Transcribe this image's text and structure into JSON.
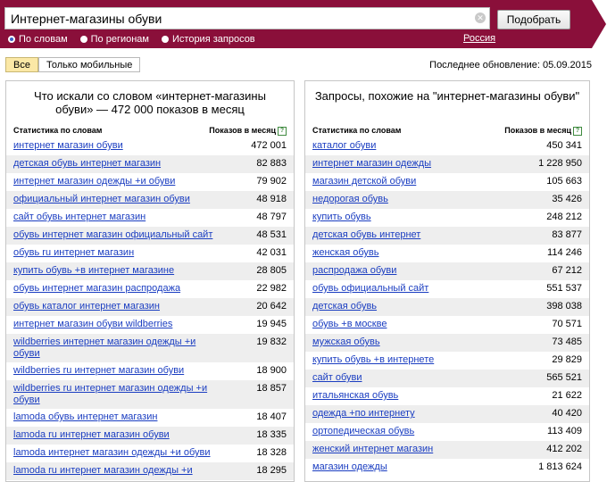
{
  "search": {
    "query": "Интернет-магазины обуви",
    "clear_symbol": "⊗",
    "button": "Подобрать",
    "modes": [
      "По словам",
      "По регионам",
      "История запросов"
    ],
    "region": "Россия"
  },
  "filters": {
    "all": "Все",
    "mobile": "Только мобильные"
  },
  "last_update": "Последнее обновление: 05.09.2015",
  "left_panel": {
    "title": "Что искали со словом «интернет-магазины обуви» — 472 000 показов в месяц",
    "col_phrase": "Статистика по словам",
    "col_count": "Показов в месяц",
    "help": "?",
    "rows": [
      {
        "phrase": "интернет магазин обуви",
        "count": "472 001"
      },
      {
        "phrase": "детская обувь интернет магазин",
        "count": "82 883"
      },
      {
        "phrase": "интернет магазин одежды +и обуви",
        "count": "79 902"
      },
      {
        "phrase": "официальный интернет магазин обуви",
        "count": "48 918"
      },
      {
        "phrase": "сайт обувь интернет магазин",
        "count": "48 797"
      },
      {
        "phrase": "обувь интернет магазин официальный сайт",
        "count": "48 531"
      },
      {
        "phrase": "обувь ru интернет магазин",
        "count": "42 031"
      },
      {
        "phrase": "купить обувь +в интернет магазине",
        "count": "28 805"
      },
      {
        "phrase": "обувь интернет магазин распродажа",
        "count": "22 982"
      },
      {
        "phrase": "обувь каталог интернет магазин",
        "count": "20 642"
      },
      {
        "phrase": "интернет магазин обуви wildberries",
        "count": "19 945"
      },
      {
        "phrase": "wildberries интернет магазин одежды +и обуви",
        "count": "19 832"
      },
      {
        "phrase": "wildberries ru интернет магазин обуви",
        "count": "18 900"
      },
      {
        "phrase": "wildberries ru интернет магазин одежды +и обуви",
        "count": "18 857"
      },
      {
        "phrase": "lamoda обувь интернет магазин",
        "count": "18 407"
      },
      {
        "phrase": "lamoda ru интернет магазин обуви",
        "count": "18 335"
      },
      {
        "phrase": "lamoda интернет магазин одежды +и обуви",
        "count": "18 328"
      },
      {
        "phrase": "lamoda ru интернет магазин одежды +и",
        "count": "18 295"
      }
    ]
  },
  "right_panel": {
    "title": "Запросы, похожие на \"интернет-магазины обуви\"",
    "col_phrase": "Статистика по словам",
    "col_count": "Показов в месяц",
    "help": "?",
    "rows": [
      {
        "phrase": "каталог обуви",
        "count": "450 341"
      },
      {
        "phrase": "интернет магазин одежды",
        "count": "1 228 950"
      },
      {
        "phrase": "магазин детской обуви",
        "count": "105 663"
      },
      {
        "phrase": "недорогая обувь",
        "count": "35 426"
      },
      {
        "phrase": "купить обувь",
        "count": "248 212"
      },
      {
        "phrase": "детская обувь интернет",
        "count": "83 877"
      },
      {
        "phrase": "женская обувь",
        "count": "114 246"
      },
      {
        "phrase": "распродажа обуви",
        "count": "67 212"
      },
      {
        "phrase": "обувь официальный сайт",
        "count": "551 537"
      },
      {
        "phrase": "детская обувь",
        "count": "398 038"
      },
      {
        "phrase": "обувь +в москве",
        "count": "70 571"
      },
      {
        "phrase": "мужская обувь",
        "count": "73 485"
      },
      {
        "phrase": "купить обувь +в интернете",
        "count": "29 829"
      },
      {
        "phrase": "сайт обуви",
        "count": "565 521"
      },
      {
        "phrase": "итальянская обувь",
        "count": "21 622"
      },
      {
        "phrase": "одежда +по интернету",
        "count": "40 420"
      },
      {
        "phrase": "ортопедическая обувь",
        "count": "113 409"
      },
      {
        "phrase": "женский интернет магазин",
        "count": "412 202"
      },
      {
        "phrase": "магазин одежды",
        "count": "1 813 624"
      }
    ]
  },
  "colors": {
    "header_bg": "#8a0f3a",
    "link": "#1a3dc1",
    "active_filter": "#fbe8a6",
    "row_alt": "#eeeeee"
  }
}
